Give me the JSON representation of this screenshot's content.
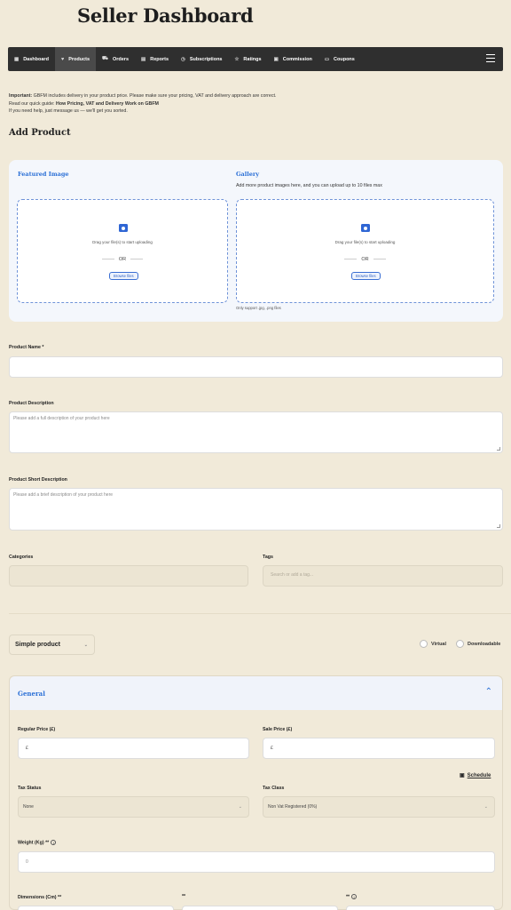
{
  "header": {
    "title": "Seller Dashboard"
  },
  "nav": {
    "items": [
      {
        "label": "Dashboard",
        "icon": "grid-icon",
        "glyph": "▦",
        "active": false
      },
      {
        "label": "Products",
        "icon": "heart-icon",
        "glyph": "♥",
        "active": true
      },
      {
        "label": "Orders",
        "icon": "cart-icon",
        "glyph": "⛟",
        "active": false
      },
      {
        "label": "Reports",
        "icon": "document-icon",
        "glyph": "▤",
        "active": false
      },
      {
        "label": "Subscriptions",
        "icon": "refresh-icon",
        "glyph": "◷",
        "active": false
      },
      {
        "label": "Ratings",
        "icon": "star-icon",
        "glyph": "☆",
        "active": false
      },
      {
        "label": "Commission",
        "icon": "calculator-icon",
        "glyph": "▣",
        "active": false
      },
      {
        "label": "Coupons",
        "icon": "ticket-icon",
        "glyph": "▭",
        "active": false
      }
    ]
  },
  "notice": {
    "important_label": "Important:",
    "line1": " GBFM includes delivery in your product price. Please make sure your pricing, VAT and delivery approach are correct.",
    "line2_prefix": "Read our quick guide: ",
    "guide_link": "How Pricing, VAT and Delivery Work on GBFM",
    "line3": "If you need help, just message us — we'll get you sorted."
  },
  "page": {
    "heading": "Add Product"
  },
  "media": {
    "featured": {
      "label": "Featured Image",
      "drag_text": "Drag your file(s) to start uploading",
      "or": "OR",
      "browse": "Browse files"
    },
    "gallery": {
      "label": "Gallery",
      "subtitle": "Add more product images here, and you can upload up to 10 files max",
      "drag_text": "Drag your file(s) to start uploading",
      "or": "OR",
      "browse": "Browse files",
      "note": "Only support .jpg, .png files"
    }
  },
  "form": {
    "product_name_label": "Product Name *",
    "description_label": "Product Description",
    "description_placeholder": "Please add a full description of your product here",
    "short_description_label": "Product Short Description",
    "short_description_placeholder": "Please add a brief description of your product here",
    "categories_label": "Categories",
    "tags_label": "Tags",
    "tags_placeholder": "Search or add a tag...",
    "product_type": "Simple product",
    "virtual_label": "Virtual",
    "downloadable_label": "Downloadable"
  },
  "general": {
    "title": "General",
    "regular_price_label": "Regular Price (£)",
    "regular_price_value": "£",
    "sale_price_label": "Sale Price (£)",
    "sale_price_value": "£",
    "schedule_label": "Schedule",
    "tax_status_label": "Tax Status",
    "tax_status_value": "None",
    "tax_class_label": "Tax Class",
    "tax_class_value": "Non Vat Registered (0%)",
    "weight_label": "Weight (Kg) **",
    "weight_placeholder": "0",
    "dimensions_label": "Dimensions (Cm) **",
    "dim2_label": "**",
    "dim3_label": "**"
  },
  "colors": {
    "accent": "#2a6fd6",
    "nav_bg": "#2f2f2f",
    "page_bg": "#f1ead9"
  }
}
